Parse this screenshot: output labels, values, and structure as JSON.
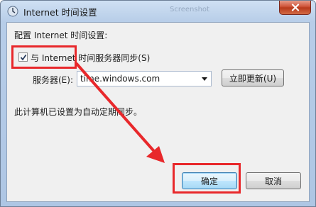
{
  "window": {
    "title": "Internet 时间设置",
    "ghost_tab_1": "",
    "ghost_tab_2": "Screenshot"
  },
  "dialog": {
    "config_label": "配置 Internet 时间设置:",
    "sync_checkbox": {
      "label": "与 Internet 时间服务器同步(S)",
      "checked": true
    },
    "server_label": "服务器(E):",
    "server_value": "time.windows.com",
    "update_now_label": "立即更新(U)",
    "status_text": "此计算机已设置为自动定期同步。",
    "ok_label": "确定",
    "cancel_label": "取消"
  },
  "annotations": {
    "highlight_color": "#e8282b",
    "arrow_color": "#e8282b"
  },
  "icons": [
    "app-icon",
    "close-icon",
    "checkmark-icon",
    "dropdown-arrow-icon"
  ]
}
